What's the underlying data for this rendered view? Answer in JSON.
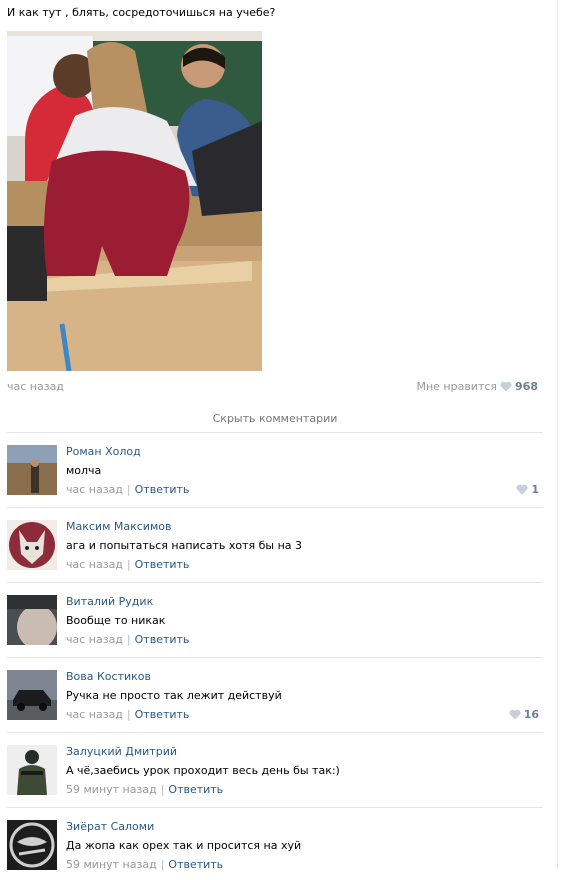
{
  "post": {
    "text": "И как тут , блять, сосредоточишься на учебе?",
    "time": "час назад",
    "like_label": "Мне нравится",
    "like_count": "968"
  },
  "hide_comments_label": "Скрыть комментарии",
  "comments": [
    {
      "author": "Роман Холод",
      "text": "молча",
      "time": "час назад",
      "reply": "Ответить",
      "likes": "1"
    },
    {
      "author": "Максим Максимов",
      "text": "ага и попытаться написать хотя бы на 3",
      "time": "час назад",
      "reply": "Ответить",
      "likes": ""
    },
    {
      "author": "Виталий Рудик",
      "text": "Вообще то никак",
      "time": "час назад",
      "reply": "Ответить",
      "likes": ""
    },
    {
      "author": "Вова Костиков",
      "text": "Ручка не просто так лежит действуй",
      "time": "час назад",
      "reply": "Ответить",
      "likes": "16"
    },
    {
      "author": "Залуцкий Дмитрий",
      "text": "А чё,заебись урок проходит весь день бы так:)",
      "time": "59 минут назад",
      "reply": "Ответить",
      "likes": ""
    },
    {
      "author": "Зиёрат Саломи",
      "text": "Да жопа как орех так и просится на хуй",
      "time": "59 минут назад",
      "reply": "Ответить",
      "likes": ""
    }
  ],
  "colors": {
    "link": "#2a5885",
    "muted": "#999999",
    "like_count": "#6b8199",
    "heart": "#c5d0db"
  },
  "icons": {
    "like": "heart-icon"
  }
}
